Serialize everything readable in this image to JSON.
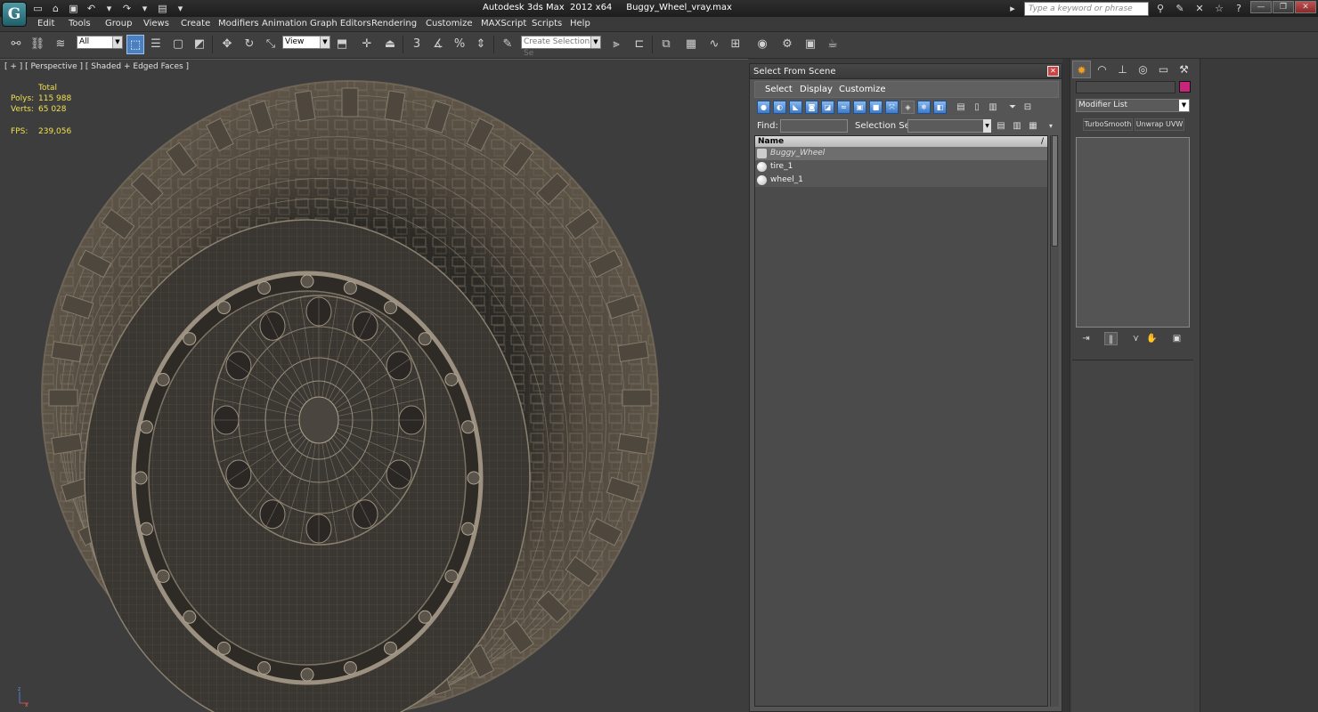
{
  "window": {
    "app_title": "Autodesk 3ds Max  2012 x64",
    "file_name": "Buggy_Wheel_vray.max",
    "search_placeholder": "Type a keyword or phrase",
    "logo_letter": "G"
  },
  "menu": [
    "Edit",
    "Tools",
    "Group",
    "Views",
    "Create",
    "Modifiers",
    "Animation",
    "Graph Editors",
    "Rendering",
    "Customize",
    "MAXScript",
    "Scripts",
    "Help"
  ],
  "toolbar": {
    "selection_filter": "All",
    "reference_coord": "View",
    "named_selection_placeholder": "Create Selection Se",
    "snap_3d": "3",
    "percent_snap": "%"
  },
  "viewport": {
    "label": "[ + ] [ Perspective ] [ Shaded + Edged Faces ]",
    "stats_header": "Total",
    "stats": [
      {
        "label": "Polys:",
        "value": "115 988"
      },
      {
        "label": "Verts:",
        "value": "65 028"
      }
    ],
    "fps_label": "FPS:",
    "fps_value": "239,056",
    "axis_z": "z",
    "axis_x": "x"
  },
  "select_from_scene": {
    "title": "Select From Scene",
    "menu": [
      "Select",
      "Display",
      "Customize"
    ],
    "find_label": "Find:",
    "selection_set_label": "Selection Set:",
    "column_header": "Name",
    "sort_indicator": "/",
    "items": [
      {
        "name": "Buggy_Wheel",
        "type": "group",
        "selected": true
      },
      {
        "name": "tire_1",
        "type": "object",
        "selected": false
      },
      {
        "name": "wheel_1",
        "type": "object",
        "selected": false
      }
    ]
  },
  "command_panel": {
    "modifier_list": "Modifier List",
    "modifiers": [
      "TurboSmooth",
      "Unwrap UVW"
    ],
    "object_color": "#c8247b"
  },
  "colors": {
    "wireframe": "#8a8070",
    "accent_blue": "#4a7fc0",
    "stats_yellow": "#f0e050"
  }
}
